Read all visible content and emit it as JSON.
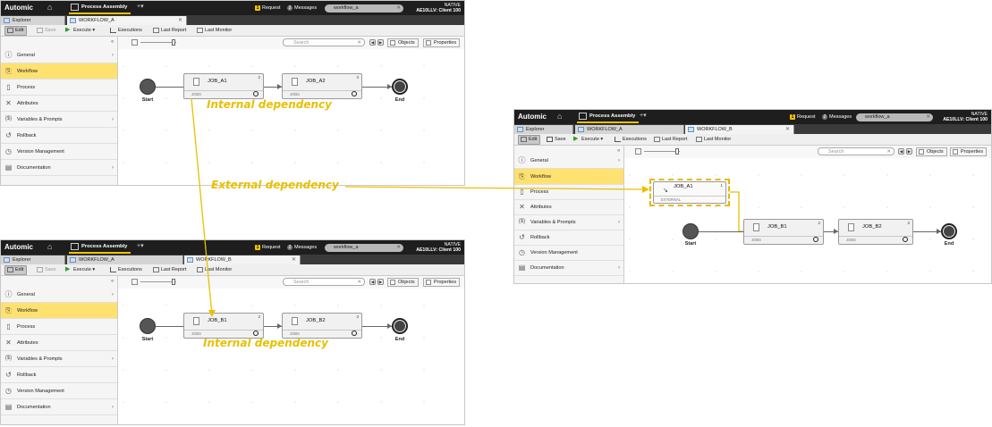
{
  "app": {
    "logo": "Automic",
    "process_assembly": "Process Assembly",
    "plus": "+",
    "request_count": "1",
    "request_label": "Request",
    "messages_count": "2",
    "messages_label": "Messages",
    "search_value": "workflow_a",
    "env_line1": "NATIVE",
    "env_line2": "AE10LLV: Client 100"
  },
  "tabs": {
    "explorer": "Explorer",
    "workflow_a": "WORKFLOW_A",
    "workflow_b": "WORKFLOW_B"
  },
  "toolbar": {
    "edit": "Edit",
    "save": "Save",
    "execute": "Execute",
    "executions": "Executions",
    "last_report": "Last Report",
    "last_monitor": "Last Monitor"
  },
  "sidebar": {
    "items": [
      "General",
      "Workflow",
      "Process",
      "Attributes",
      "Variables & Prompts",
      "Rollback",
      "Version Management",
      "Documentation"
    ]
  },
  "canvas": {
    "search_placeholder": "Search",
    "objects": "Objects",
    "properties": "Properties",
    "start": "Start",
    "end": "End",
    "jobs_tag": "JOBS",
    "external_tag": "EXTERNAL"
  },
  "workflow_a_jobs": [
    {
      "name": "JOB_A1",
      "num": "2"
    },
    {
      "name": "JOB_A2",
      "num": "3"
    }
  ],
  "workflow_b_jobs": [
    {
      "name": "JOB_B1",
      "num": "2"
    },
    {
      "name": "JOB_B2",
      "num": "3"
    }
  ],
  "external_job": {
    "name": "JOB_A1",
    "num": "1"
  },
  "annotations": {
    "internal_1": "Internal dependency",
    "internal_2": "Internal dependency",
    "external": "External dependency"
  },
  "colors": {
    "accent": "#f4c400",
    "annotation": "#e8c000",
    "sidebar_active": "#ffe170",
    "topbar": "#1e1e1e"
  }
}
